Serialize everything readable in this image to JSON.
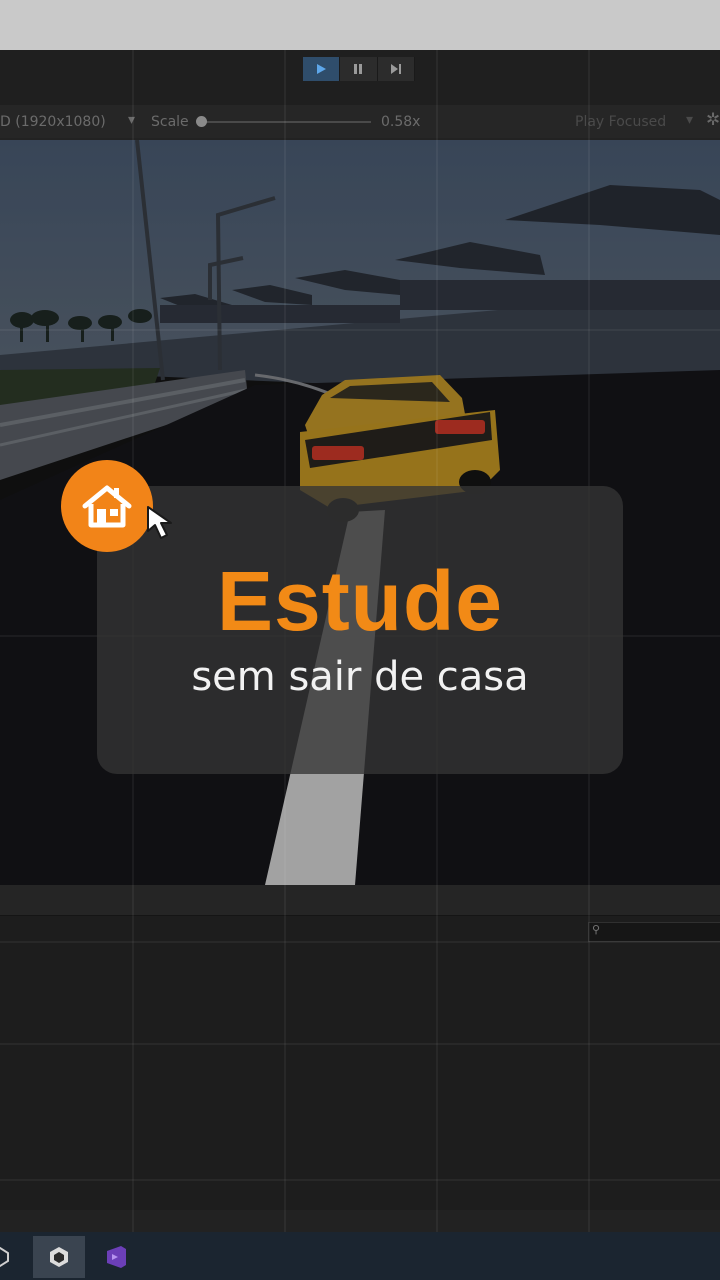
{
  "toolbar": {
    "play_icon": "play-icon",
    "pause_icon": "pause-icon",
    "step_icon": "step-icon"
  },
  "game_bar": {
    "resolution": "D (1920x1080)",
    "scale_label": "Scale",
    "scale_value": "0.58x",
    "play_mode": "Play Focused"
  },
  "overlay": {
    "headline": "Estude",
    "subline": "sem sair de casa",
    "badge_icon": "home-icon",
    "cursor_icon": "cursor-arrow-icon"
  },
  "taskbar": {
    "apps": [
      "unity-hub-icon",
      "unity-editor-icon",
      "visual-studio-icon"
    ]
  },
  "colors": {
    "accent_orange": "#f28a16",
    "white_text": "#f2f2f2",
    "card_bg": "#343434"
  }
}
